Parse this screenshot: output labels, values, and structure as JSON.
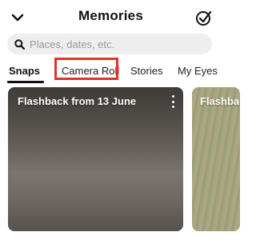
{
  "header": {
    "title": "Memories",
    "back_icon": "chevron-down-icon",
    "select_icon": "check-circle-icon"
  },
  "search": {
    "placeholder": "Places, dates, etc.",
    "value": "",
    "icon": "search-icon"
  },
  "tabs": [
    {
      "label": "Snaps",
      "active": true
    },
    {
      "label": "Camera Roll",
      "active": false,
      "highlighted": true
    },
    {
      "label": "Stories",
      "active": false
    },
    {
      "label": "My Eyes",
      "active": false
    }
  ],
  "tiles": [
    {
      "label": "Flashback from 13 June",
      "menu_icon": "more-vertical-icon"
    },
    {
      "label": "Flashback"
    }
  ],
  "colors": {
    "highlight": "#e33326",
    "search_bg": "#eeeef0",
    "active_tab_underline": "#111111"
  }
}
